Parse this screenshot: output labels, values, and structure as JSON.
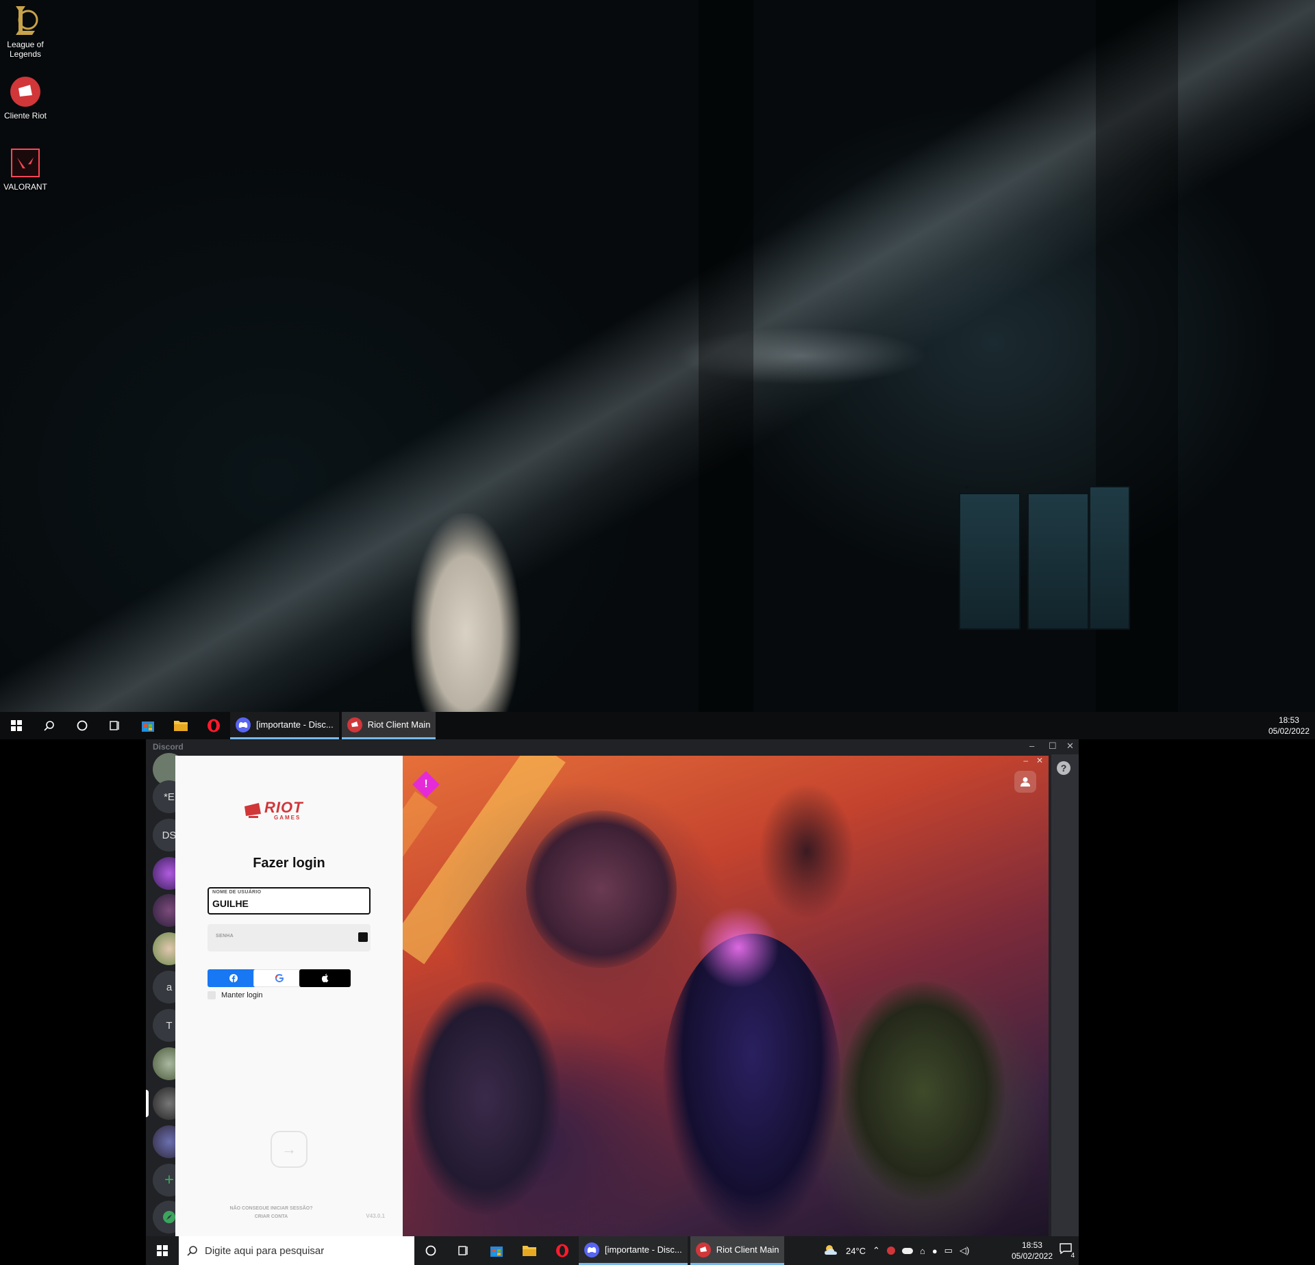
{
  "desktop_icons": [
    {
      "label_line1": "League of",
      "label_line2": "Legends",
      "icon": "league-of-legends-icon"
    },
    {
      "label_line1": "Cliente Riot",
      "label_line2": "",
      "icon": "riot-client-icon"
    },
    {
      "label_line1": "VALORANT",
      "label_line2": "",
      "icon": "valorant-icon"
    }
  ],
  "taskbar_top": {
    "apps": [
      {
        "label": "[importante - Disc...",
        "icon": "discord-icon"
      },
      {
        "label": "Riot Client Main",
        "icon": "riot-client-icon"
      }
    ],
    "time": "18:53",
    "date": "05/02/2022"
  },
  "discord": {
    "title": "Discord",
    "servers": [
      "*E",
      "DS",
      "a",
      "T"
    ]
  },
  "riot_client": {
    "logo_word": "RIOT",
    "logo_sub": "GAMES",
    "login_title": "Fazer login",
    "username_label": "NOME DE USUÁRIO",
    "username_value": "GUILHE",
    "password_label": "SENHA",
    "social": {
      "facebook": "f",
      "google": "G",
      "apple": ""
    },
    "remember_label": "Manter login",
    "help_line1": "NÃO CONSEGUE INICIAR SESSÃO?",
    "help_line2": "CRIAR CONTA",
    "version": "V43.0.1",
    "alert_symbol": "!"
  },
  "taskbar_bottom": {
    "search_placeholder": "Digite aqui para pesquisar",
    "apps": [
      {
        "label": "[importante - Disc...",
        "icon": "discord-icon"
      },
      {
        "label": "Riot Client Main",
        "icon": "riot-client-icon"
      }
    ],
    "weather": "24°C",
    "time": "18:53",
    "date": "05/02/2022",
    "notifications": "4"
  },
  "colors": {
    "riot_red": "#d13639",
    "discord_blurple": "#5865f2",
    "alert_pink": "#e52bd8",
    "facebook_blue": "#1877f2"
  }
}
